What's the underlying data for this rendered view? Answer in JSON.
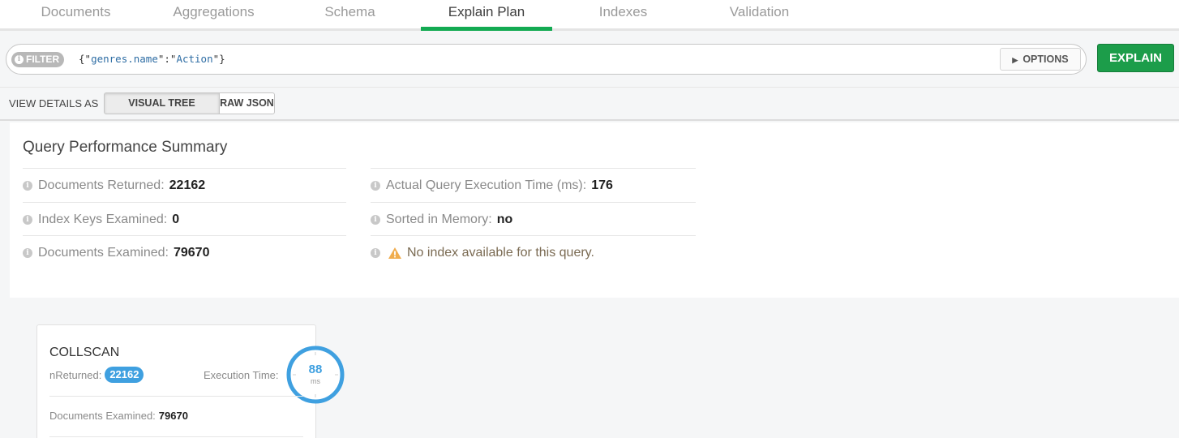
{
  "tabs": [
    {
      "label": "Documents",
      "active": false
    },
    {
      "label": "Aggregations",
      "active": false
    },
    {
      "label": "Schema",
      "active": false
    },
    {
      "label": "Explain Plan",
      "active": true
    },
    {
      "label": "Indexes",
      "active": false
    },
    {
      "label": "Validation",
      "active": false
    }
  ],
  "filter": {
    "label": "FILTER",
    "query_open": "{\"",
    "query_key": "genres.name",
    "query_mid": "\":\"",
    "query_value": "Action",
    "query_close": "\"}",
    "options_label": "OPTIONS",
    "explain_label": "EXPLAIN"
  },
  "view_details": {
    "label": "VIEW DETAILS AS",
    "visual_tree": "VISUAL TREE",
    "raw_json": "RAW JSON",
    "selected": "VISUAL TREE"
  },
  "summary": {
    "title": "Query Performance Summary",
    "left": [
      {
        "label": "Documents Returned:",
        "value": "22162"
      },
      {
        "label": "Index Keys Examined:",
        "value": "0"
      },
      {
        "label": "Documents Examined:",
        "value": "79670"
      }
    ],
    "right": [
      {
        "label": "Actual Query Execution Time (ms):",
        "value": "176"
      },
      {
        "label": "Sorted in Memory:",
        "value": "no"
      }
    ],
    "warning": "No index available for this query."
  },
  "stage": {
    "name": "COLLSCAN",
    "nreturned_label": "nReturned:",
    "nreturned_value": "22162",
    "exec_time_label": "Execution Time:",
    "exec_time_value": "88",
    "exec_time_unit": "ms",
    "docs_examined_label": "Documents Examined:",
    "docs_examined_value": "79670"
  },
  "colors": {
    "active_tab_underline": "#13aa52",
    "explain_button": "#1c9d4a",
    "badge": "#3fa0e0",
    "warning": "#f0ad4e"
  }
}
